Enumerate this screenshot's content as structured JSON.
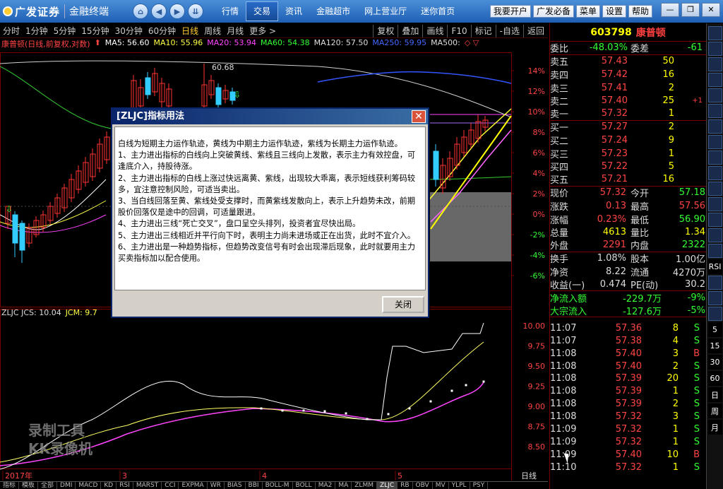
{
  "app": {
    "logo_text": "广发证券",
    "logo_sub": "金融终端"
  },
  "topnav": {
    "menu": [
      "行情",
      "交易",
      "资讯",
      "金融超市",
      "网上营业厅",
      "迷你首页"
    ],
    "active_menu": "交易",
    "right_buttons": [
      "我要开户",
      "广发必备",
      "菜单",
      "设置",
      "帮助"
    ]
  },
  "periods": [
    "分时",
    "1分钟",
    "5分钟",
    "15分钟",
    "30分钟",
    "60分钟",
    "日线",
    "周线",
    "月线",
    "更多 >"
  ],
  "active_period": "日线",
  "tools": [
    "复权",
    "叠加",
    "画线",
    "F10",
    "标记",
    "-自选",
    "返回"
  ],
  "kline_legend": {
    "title": "康普顿(日线,前复权,对数)",
    "ma5": "MA5: 56.60",
    "ma10": "MA10: 55.96",
    "ma20": "MA20: 53.94",
    "ma60": "MA60: 54.38",
    "ma120": "MA120: 57.50",
    "ma250": "MA250: 59.95",
    "ma500": "MA500:"
  },
  "kline_axis": {
    "pct_labels": [
      "14%",
      "12%",
      "10%",
      "8%",
      "6%",
      "4%",
      "2%",
      "0%",
      "-2%",
      "-4%",
      "-6%"
    ],
    "high_label": "60.68"
  },
  "indicator_legend": {
    "title": "ZLJC JCS: 10.04",
    "jcm": "JCM: 9.7"
  },
  "indicator_axis": {
    "labels": [
      "10.00",
      "9.75",
      "9.50",
      "9.25",
      "9.00",
      "8.75",
      "8.50"
    ]
  },
  "x_axis": {
    "labels": [
      "2017年",
      "3",
      "4",
      "5"
    ],
    "right_label": "日线"
  },
  "bottom_tabs": [
    "指标",
    "模板",
    "全部",
    "DMI",
    "MACD",
    "KD",
    "RSI",
    "MARST",
    "CCI",
    "EXPMA",
    "WR",
    "BIAS",
    "BBI",
    "BOLL-M",
    "BOLL",
    "MA2",
    "MA",
    "ZLMM",
    "ZLJC",
    "RB",
    "OBV",
    "MV",
    "YLPL",
    "PSY"
  ],
  "active_bottom_tab": "ZLJC",
  "quote": {
    "code": "603798",
    "name": "康普顿",
    "webi_label": "委比",
    "webi_value": "-48.03%",
    "weicha_label": "委差",
    "weicha_value": "-61",
    "sells": [
      {
        "label": "卖五",
        "price": "57.43",
        "vol": "50"
      },
      {
        "label": "卖四",
        "price": "57.42",
        "vol": "16"
      },
      {
        "label": "卖三",
        "price": "57.41",
        "vol": "2"
      },
      {
        "label": "卖二",
        "price": "57.40",
        "vol": "25",
        "extra": "+1"
      },
      {
        "label": "卖一",
        "price": "57.32",
        "vol": "1"
      }
    ],
    "buys": [
      {
        "label": "买一",
        "price": "57.27",
        "vol": "2"
      },
      {
        "label": "买二",
        "price": "57.24",
        "vol": "9"
      },
      {
        "label": "买三",
        "price": "57.23",
        "vol": "1"
      },
      {
        "label": "买四",
        "price": "57.22",
        "vol": "5"
      },
      {
        "label": "买五",
        "price": "57.21",
        "vol": "16"
      }
    ],
    "stats": [
      {
        "l1": "现价",
        "v1": "57.32",
        "l2": "今开",
        "v2": "57.18"
      },
      {
        "l1": "涨跌",
        "v1": "0.13",
        "l2": "最高",
        "v2": "57.56"
      },
      {
        "l1": "涨幅",
        "v1": "0.23%",
        "l2": "最低",
        "v2": "56.90"
      },
      {
        "l1": "总量",
        "v1": "4613",
        "l2": "量比",
        "v2": "1.34"
      },
      {
        "l1": "外盘",
        "v1": "2291",
        "l2": "内盘",
        "v2": "2322"
      }
    ],
    "stats2": [
      {
        "l1": "换手",
        "v1": "1.08%",
        "l2": "股本",
        "v2": "1.00亿"
      },
      {
        "l1": "净资",
        "v1": "8.22",
        "l2": "流通",
        "v2": "4270万"
      },
      {
        "l1": "收益(一)",
        "v1": "0.474",
        "l2": "PE(动)",
        "v2": "30.2"
      }
    ],
    "flows": [
      {
        "label": "净流入额",
        "value": "-229.7万",
        "pct": "-9%"
      },
      {
        "label": "大宗流入",
        "value": "-127.6万",
        "pct": "-5%"
      }
    ],
    "ticks": [
      {
        "time": "11:07",
        "price": "57.36",
        "vol": "8",
        "dir": "S"
      },
      {
        "time": "11:07",
        "price": "57.38",
        "vol": "4",
        "dir": "S"
      },
      {
        "time": "11:08",
        "price": "57.40",
        "vol": "3",
        "dir": "B"
      },
      {
        "time": "11:08",
        "price": "57.40",
        "vol": "2",
        "dir": "S"
      },
      {
        "time": "11:08",
        "price": "57.39",
        "vol": "20",
        "dir": "S"
      },
      {
        "time": "11:08",
        "price": "57.39",
        "vol": "1",
        "dir": "S"
      },
      {
        "time": "11:08",
        "price": "57.39",
        "vol": "2",
        "dir": "S"
      },
      {
        "time": "11:08",
        "price": "57.32",
        "vol": "3",
        "dir": "S"
      },
      {
        "time": "11:09",
        "price": "57.32",
        "vol": "1",
        "dir": "S"
      },
      {
        "time": "11:09",
        "price": "57.32",
        "vol": "1",
        "dir": "S"
      },
      {
        "time": "11:09",
        "price": "57.40",
        "vol": "10",
        "dir": "B"
      },
      {
        "time": "11:10",
        "price": "57.32",
        "vol": "1",
        "dir": "S"
      }
    ]
  },
  "icon_strip": {
    "texts": [
      "RSI",
      "5",
      "15",
      "30",
      "60",
      "日",
      "周",
      "月"
    ]
  },
  "dialog": {
    "title": "[ZLJC]指标用法",
    "paragraphs": [
      "白线为短期主力运作轨迹，黄线为中期主力运作轨迹，紫线为长期主力运作轨迹。",
      "1、主力进出指标的白线向上突破黄线、紫线且三线向上发散，表示主力有效控盘，可逢底介入，持股待涨。",
      "2、主力进出指标的白线上涨过快远离黄、紫线，出现较大乖离，表示短线获利筹码较多，宜注意控制风险，可适当卖出。",
      "3、当白线回落至黄、紫线处受支撑时，而黄紫线发散向上，表示上升趋势未改，前期股价回落仅是途中的回调，可适量跟进。",
      "4、主力进出三线“死亡交叉”，盘口呈空头排列，投资者宜尽快出局。",
      "5、主力进出三线相近并平行向下时，表明主力尚未进场或正在出货，此时不宜介入。",
      "6、主力进出是一种趋势指标，但趋势改变信号有时会出现滞后现象，此时就要用主力买卖指标加以配合使用。"
    ],
    "close_label": "关闭"
  },
  "watermark": {
    "line1": "录制工具",
    "line2": "KK录像机"
  },
  "colors": {
    "up": "#ff3333",
    "down": "#33ccff",
    "white_line": "#ffffff",
    "yellow_line": "#ffff66",
    "purple_line": "#ff44ff"
  }
}
